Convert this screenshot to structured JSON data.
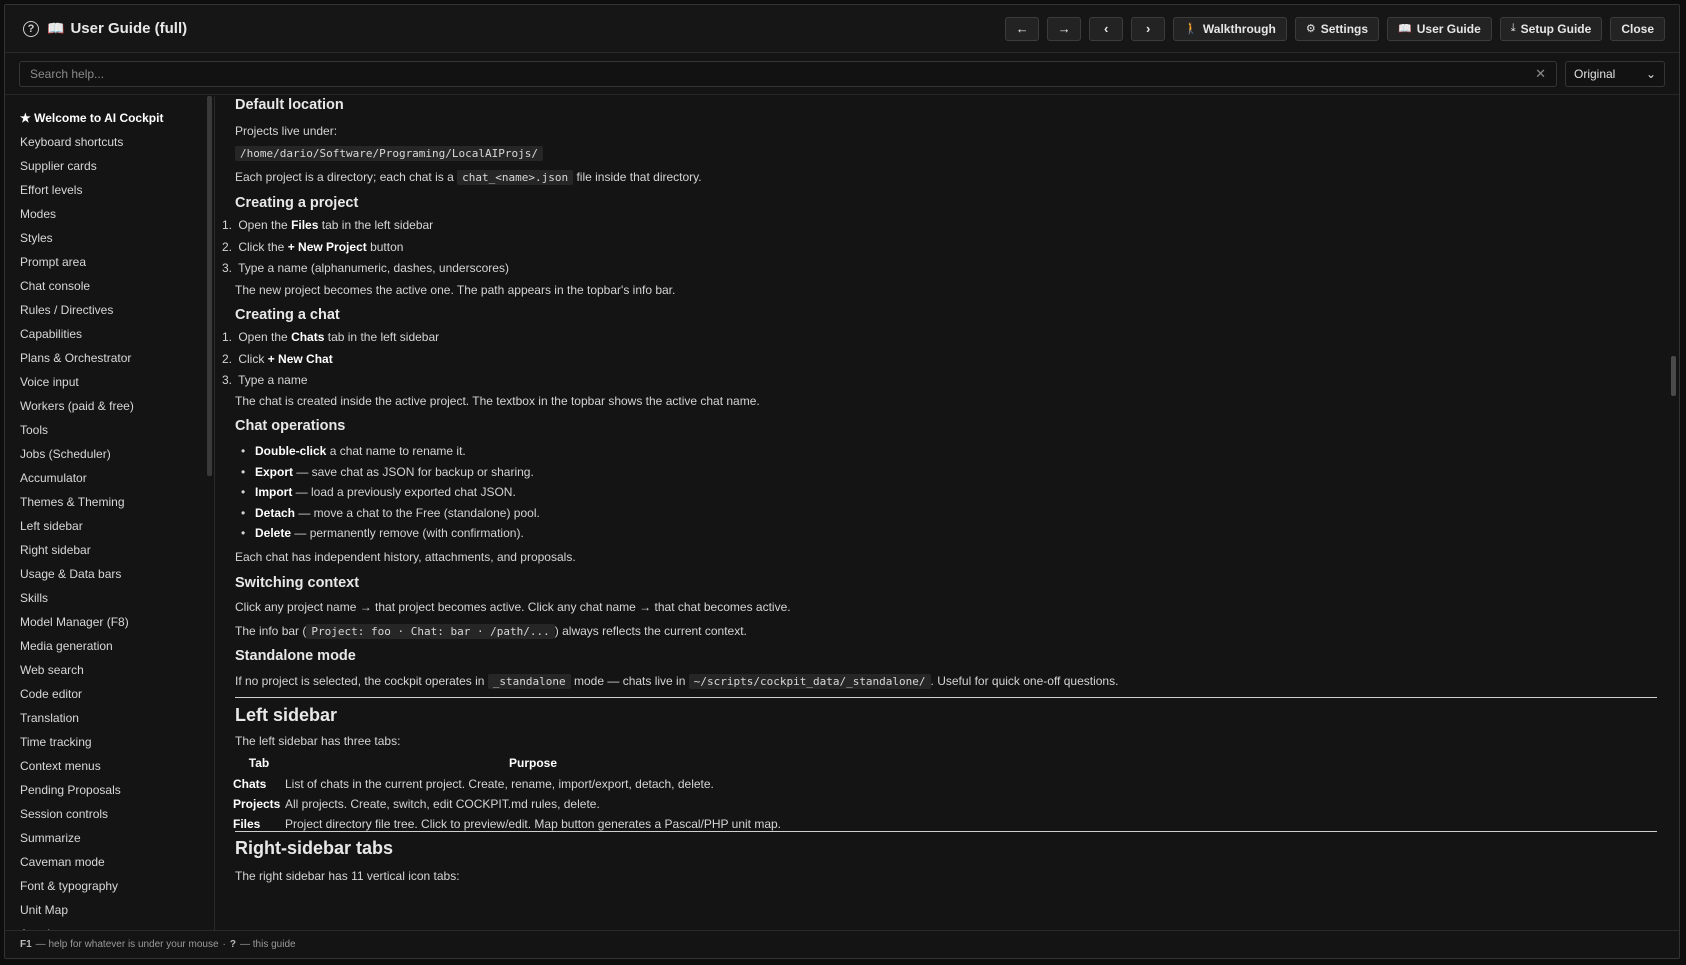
{
  "header": {
    "title": "User Guide (full)",
    "buttons": {
      "walkthrough": "Walkthrough",
      "settings": "Settings",
      "user_guide": "User Guide",
      "setup_guide": "Setup Guide",
      "close": "Close"
    }
  },
  "search": {
    "placeholder": "Search help...",
    "mode": "Original"
  },
  "sidebar": {
    "items": [
      "★ Welcome to AI Cockpit",
      "Keyboard shortcuts",
      "Supplier cards",
      "Effort levels",
      "Modes",
      "Styles",
      "Prompt area",
      "Chat console",
      "Rules / Directives",
      "Capabilities",
      "Plans & Orchestrator",
      "Voice input",
      "Workers (paid & free)",
      "Tools",
      "Jobs (Scheduler)",
      "Accumulator",
      "Themes & Theming",
      "Left sidebar",
      "Right sidebar",
      "Usage & Data bars",
      "Skills",
      "Model Manager (F8)",
      "Media generation",
      "Web search",
      "Code editor",
      "Translation",
      "Time tracking",
      "Context menus",
      "Pending Proposals",
      "Session controls",
      "Summarize",
      "Caveman mode",
      "Font & typography",
      "Unit Map",
      "Attachments"
    ]
  },
  "content": {
    "default_location": {
      "heading": "Default location",
      "intro": "Projects live under:",
      "path": "/home/dario/Software/Programing/LocalAIProjs/",
      "each_pre": "Each project is a directory; each chat is a",
      "each_code": "chat_<name>.json",
      "each_post": "file inside that directory."
    },
    "creating_project": {
      "heading": "Creating a project",
      "s1_pre": "Open the",
      "s1_b": "Files",
      "s1_post": "tab in the left sidebar",
      "s2_pre": "Click the",
      "s2_b": "+ New Project",
      "s2_post": "button",
      "s3": "Type a name (alphanumeric, dashes, underscores)",
      "note": "The new project becomes the active one. The path appears in the topbar's info bar."
    },
    "creating_chat": {
      "heading": "Creating a chat",
      "s1_pre": "Open the",
      "s1_b": "Chats",
      "s1_post": "tab in the left sidebar",
      "s2_pre": "Click",
      "s2_b": "+ New Chat",
      "s3": "Type a name",
      "note": "The chat is created inside the active project. The textbox in the topbar shows the active chat name."
    },
    "chat_operations": {
      "heading": "Chat operations",
      "items": [
        {
          "b": "Double-click",
          "t": " a chat name to rename it."
        },
        {
          "b": "Export",
          "t": " — save chat as JSON for backup or sharing."
        },
        {
          "b": "Import",
          "t": " — load a previously exported chat JSON."
        },
        {
          "b": "Detach",
          "t": " — move a chat to the Free (standalone) pool."
        },
        {
          "b": "Delete",
          "t": " — permanently remove (with confirmation)."
        }
      ],
      "note": "Each chat has independent history, attachments, and proposals."
    },
    "switching": {
      "heading": "Switching context",
      "line1": "Click any project name → that project becomes active. Click any chat name → that chat becomes active.",
      "pre": "The info bar (",
      "code": "Project: foo · Chat: bar · /path/...",
      "post": ") always reflects the current context."
    },
    "standalone": {
      "heading": "Standalone mode",
      "pre": "If no project is selected, the cockpit operates in",
      "code1": "_standalone",
      "mid": "mode — chats live in",
      "code2": "~/scripts/cockpit_data/_standalone/",
      "post": ". Useful for quick one-off questions."
    },
    "left_sidebar": {
      "heading": "Left sidebar",
      "intro": "The left sidebar has three tabs:",
      "col_tab": "Tab",
      "col_purpose": "Purpose",
      "rows": [
        {
          "tab": "Chats",
          "purpose": "List of chats in the current project. Create, rename, import/export, detach, delete."
        },
        {
          "tab": "Projects",
          "purpose": "All projects. Create, switch, edit COCKPIT.md rules, delete."
        },
        {
          "tab": "Files",
          "purpose": "Project directory file tree. Click to preview/edit. Map button generates a Pascal/PHP unit map."
        }
      ]
    },
    "right_sidebar": {
      "heading": "Right-sidebar tabs",
      "intro": "The right sidebar has 11 vertical icon tabs:"
    }
  },
  "status": {
    "f1_key": "F1",
    "f1_text": "— help for whatever is under your mouse",
    "sep": "·",
    "q_key": "?",
    "q_text": "— this guide"
  }
}
